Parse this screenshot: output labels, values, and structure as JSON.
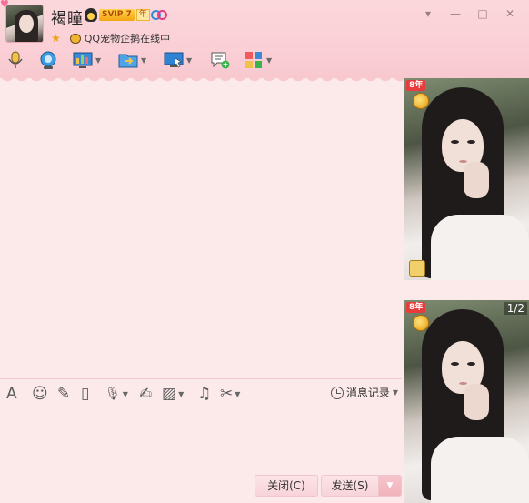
{
  "header": {
    "nickname": "褐瞳",
    "svip_badge": "SVIP 7",
    "svip_year": "年",
    "status_text": "QQ宠物企鹅在线中",
    "window_controls": [
      "chevron-down-icon",
      "minimize-icon",
      "maximize-icon",
      "close-icon"
    ]
  },
  "toolbar": {
    "items": [
      {
        "icon": "microphone-icon",
        "caret": false
      },
      {
        "icon": "video-camera-icon",
        "caret": false
      },
      {
        "icon": "remote-desktop-icon",
        "caret": true
      },
      {
        "icon": "file-transfer-icon",
        "caret": true
      },
      {
        "icon": "screen-share-icon",
        "caret": true
      },
      {
        "icon": "add-discussion-icon",
        "caret": false
      },
      {
        "icon": "app-grid-icon",
        "caret": true
      }
    ]
  },
  "input_toolbar": {
    "items": [
      {
        "icon": "font-icon",
        "glyph": "A",
        "caret": false
      },
      {
        "icon": "emoji-icon",
        "glyph": "☺",
        "caret": false
      },
      {
        "icon": "magic-wand-icon",
        "glyph": "✎",
        "caret": false
      },
      {
        "icon": "screen-shake-icon",
        "glyph": "▯",
        "caret": false
      },
      {
        "icon": "voice-message-icon",
        "glyph": "🎙",
        "caret": true
      },
      {
        "icon": "doodle-icon",
        "glyph": "✍",
        "caret": false
      },
      {
        "icon": "image-icon",
        "glyph": "▨",
        "caret": true
      },
      {
        "icon": "music-icon",
        "glyph": "♫",
        "caret": false
      },
      {
        "icon": "scissors-icon",
        "glyph": "✂",
        "caret": true
      }
    ],
    "history_label": "消息记录"
  },
  "buttons": {
    "close_label": "关闭(C)",
    "send_label": "发送(S)"
  },
  "photos": {
    "tag": "8年",
    "pager": "1/2"
  },
  "colors": {
    "header_pink": "#fad0d6",
    "body_pink": "#fce9ea",
    "button_border": "#f0c6cc"
  }
}
